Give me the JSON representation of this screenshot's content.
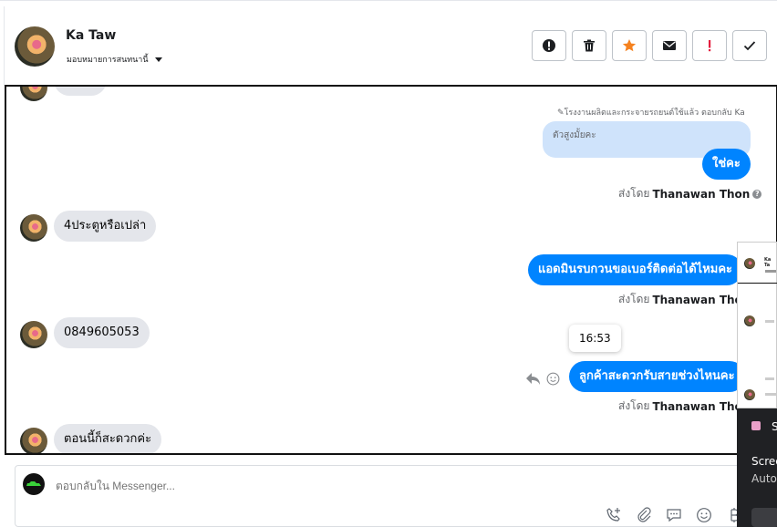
{
  "header": {
    "name": "Ka Taw",
    "assign_label": "มอบหมายการสนทนานี้"
  },
  "actions": [
    "mark-spam-icon",
    "trash-icon",
    "star-icon",
    "envelope-icon",
    "exclamation-icon",
    "check-icon"
  ],
  "colors": {
    "outgoing": "#0084ff",
    "incoming": "#e4e6eb",
    "quote": "#cfe3fb",
    "star": "#f5821f",
    "alert": "#e41e3f"
  },
  "conversation": {
    "quote_label": "✎โรงงานผลิตและกระจายรถยนต์ใช้แล้ว ตอบกลับ Ka",
    "quote_text": "ตัวสูงมั้ยคะ",
    "messages": {
      "out1": "ใช่คะ",
      "in1": "4ประตูหรือเปล่า",
      "out2": "แอดมินรบกวนขอเบอร์ติดต่อได้ไหมคะ",
      "in2": "0849605053",
      "out3": "ลูกค้าสะดวกรับสายช่วงไหนคะ",
      "in3": "ตอนนี้ก็สะดวกค่ะ"
    },
    "sent_by_prefix": "ส่งโดย",
    "sent_by_name": "Thanawan Thon",
    "tooltip_time": "16:53"
  },
  "composer": {
    "placeholder": "ตอบกลับใน Messenger..."
  },
  "overlay": {
    "thumb_name": "Ka Ta",
    "text_s": "S",
    "text_line1": "Scree",
    "text_line2": "Auto"
  }
}
